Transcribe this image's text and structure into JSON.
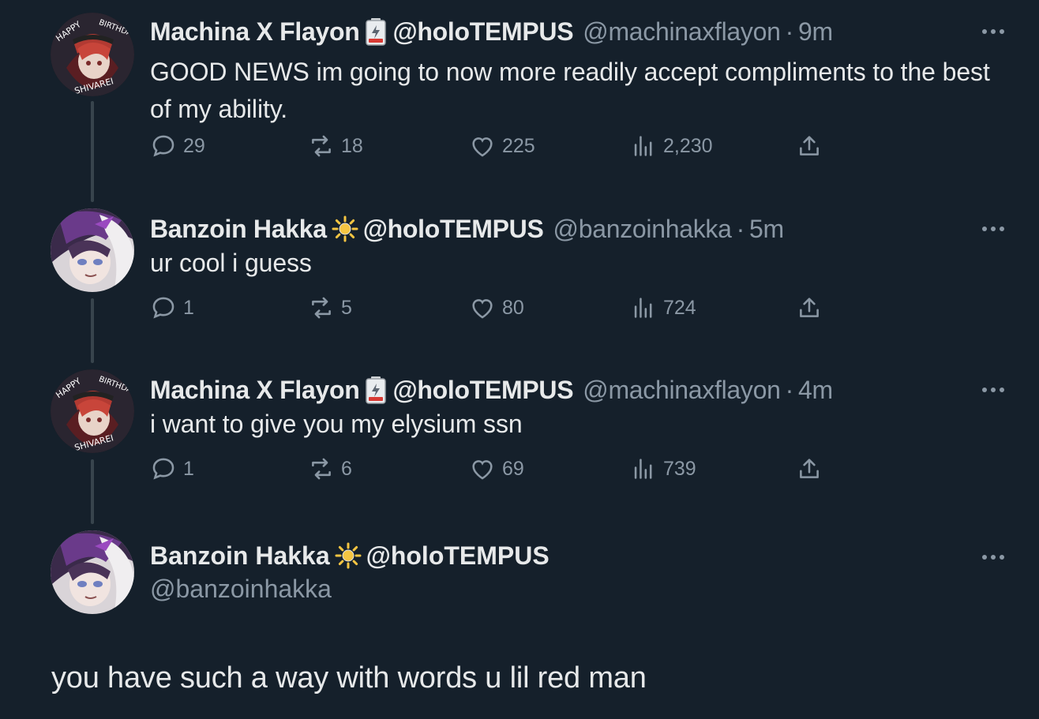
{
  "colors": {
    "background": "#15202b",
    "primary_text": "#e7e9ea",
    "secondary_text": "#8b98a5",
    "thread_line": "#38444d"
  },
  "tweets": [
    {
      "name": "Machina X Flayon",
      "emoji_icon": "battery-low-icon",
      "affiliation": "@holoTEMPUS",
      "handle": "@machinaxflayon",
      "separator": "·",
      "time": "9m",
      "text": "GOOD NEWS im going to now more readily accept compliments to the best of my ability.",
      "replies": "29",
      "retweets": "18",
      "likes": "225",
      "views": "2,230"
    },
    {
      "name": "Banzoin Hakka",
      "emoji_icon": "sun-icon",
      "affiliation": "@holoTEMPUS",
      "handle": "@banzoinhakka",
      "separator": "·",
      "time": "5m",
      "text": "ur cool i guess",
      "replies": "1",
      "retweets": "5",
      "likes": "80",
      "views": "724"
    },
    {
      "name": "Machina X Flayon",
      "emoji_icon": "battery-low-icon",
      "affiliation": "@holoTEMPUS",
      "handle": "@machinaxflayon",
      "separator": "·",
      "time": "4m",
      "text": "i want to give you my elysium ssn",
      "replies": "1",
      "retweets": "6",
      "likes": "69",
      "views": "739"
    }
  ],
  "main_tweet": {
    "name": "Banzoin Hakka",
    "emoji_icon": "sun-icon",
    "affiliation": "@holoTEMPUS",
    "handle": "@banzoinhakka",
    "text": "you have such a way with words u lil red man"
  }
}
